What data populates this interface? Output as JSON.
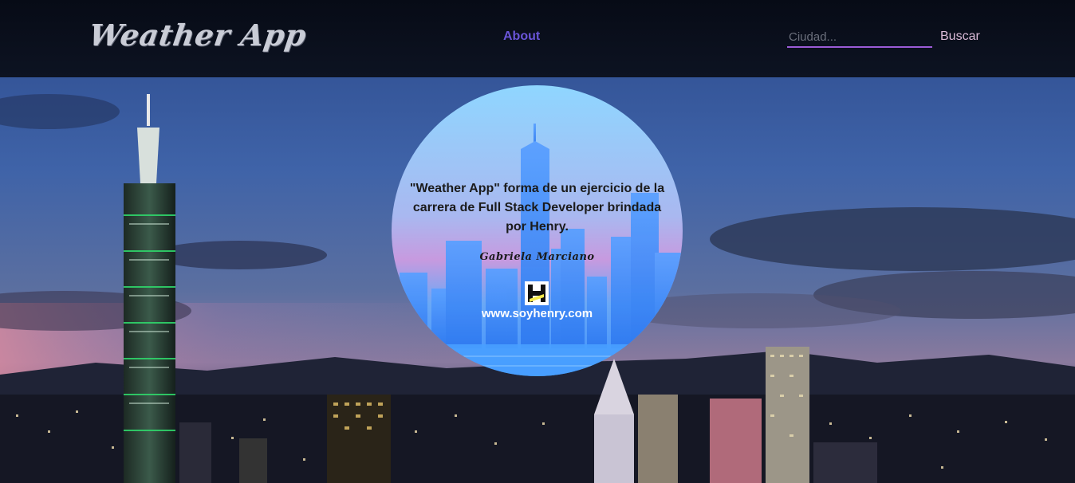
{
  "navbar": {
    "brand": "Weather App",
    "about_label": "About",
    "search_placeholder": "Ciudad...",
    "search_button": "Buscar"
  },
  "about": {
    "description": "\"Weather App\" forma de un ejercicio de la carrera de Full Stack Developer brindada por Henry.",
    "signature": "Gabriela Marciano",
    "url": "www.soyhenry.com"
  },
  "colors": {
    "navbar_bg": "#0d1322",
    "accent": "#6a55d8",
    "search_underline": "#9b5bd6",
    "brand_text": "#c9ccd6",
    "card_gradient_top": "#8fd0ff",
    "card_gradient_bottom": "#3a8fff"
  },
  "icons": {
    "henry_logo": "henry-logo-icon"
  }
}
